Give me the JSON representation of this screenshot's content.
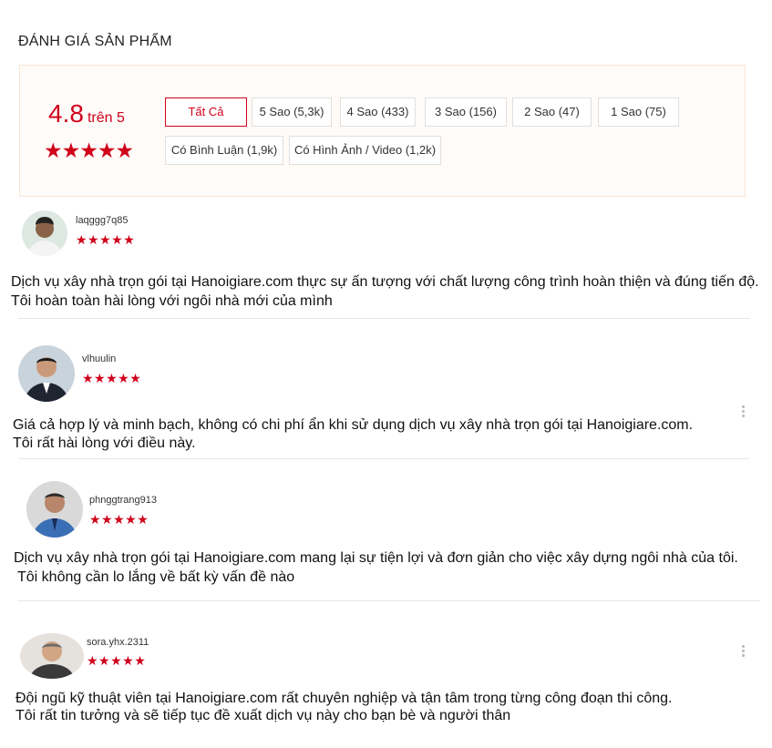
{
  "page": {
    "title": "ĐÁNH GIÁ SẢN PHẨM"
  },
  "rating": {
    "score": "4.8",
    "out_of": "trên 5",
    "stars": "★★★★★"
  },
  "filters": {
    "all": "Tất Cả",
    "five": "5 Sao (5,3k)",
    "four": "4 Sao (433)",
    "three": "3 Sao (156)",
    "two": "2 Sao (47)",
    "one": "1 Sao (75)",
    "comments": "Có Bình Luận (1,9k)",
    "media": "Có Hình Ảnh / Video (1,2k)"
  },
  "colors": {
    "accent": "#d0011b",
    "panel_bg": "#fffbf8"
  },
  "reviews": [
    {
      "username": "laqggg7q85",
      "stars": "★★★★★",
      "line1": "Dịch vụ xây nhà trọn gói tại Hanoigiare.com thực sự ấn tượng với chất lượng công trình hoàn thiện và đúng tiến độ.",
      "line2": "Tôi hoàn toàn hài lòng với ngôi nhà mới của mình"
    },
    {
      "username": "vlhuulin",
      "stars": "★★★★★",
      "line1": "Giá cả hợp lý và minh bạch, không có chi phí ẩn khi sử dụng dịch vụ xây nhà trọn gói tại Hanoigiare.com.",
      "line2": "Tôi rất hài lòng với điều này."
    },
    {
      "username": "phnggtrang913",
      "stars": "★★★★★",
      "line1": "Dịch vụ xây nhà trọn gói tại Hanoigiare.com mang lại sự tiện lợi và đơn giản cho việc xây dựng ngôi nhà của tôi.",
      "line2": "Tôi không cần lo lắng về bất kỳ vấn đề nào"
    },
    {
      "username": "sora.yhx.2311",
      "stars": "★★★★★",
      "line1": "Đội ngũ kỹ thuật viên tại Hanoigiare.com rất chuyên nghiệp và tận tâm trong từng công đoạn thi công.",
      "line2": "Tôi rất tin tưởng và sẽ tiếp tục đề xuất dịch vụ này cho bạn bè và người thân"
    }
  ]
}
